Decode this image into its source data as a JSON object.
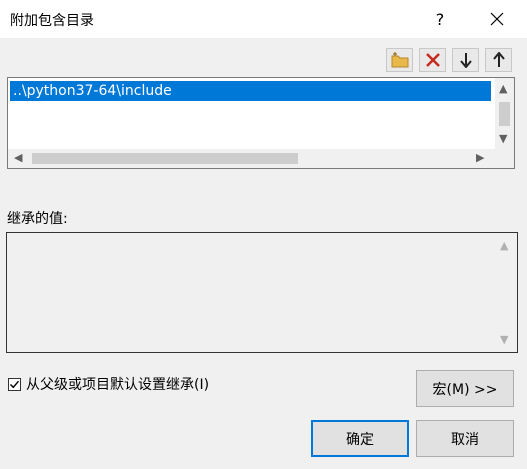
{
  "window": {
    "title": "附加包含目录",
    "help_label": "?",
    "close_label": "✕"
  },
  "toolbar": {
    "new_line_icon": "new-folder-icon",
    "delete_icon": "delete-x-icon",
    "move_down_icon": "arrow-down-icon",
    "move_up_icon": "arrow-up-icon"
  },
  "directories": {
    "items": [
      "..\\python37-64\\include"
    ],
    "selected_index": 0
  },
  "inherited": {
    "label": "继承的值:",
    "values": []
  },
  "options": {
    "inherit_checkbox_label": "从父级或项目默认设置继承(I)",
    "inherit_checked": true
  },
  "buttons": {
    "macro_label": "宏(M) >>",
    "ok_label": "确定",
    "cancel_label": "取消"
  },
  "colors": {
    "selection": "#0078d7",
    "delete_red": "#c42b1c",
    "folder_yellow": "#e8b84a"
  }
}
